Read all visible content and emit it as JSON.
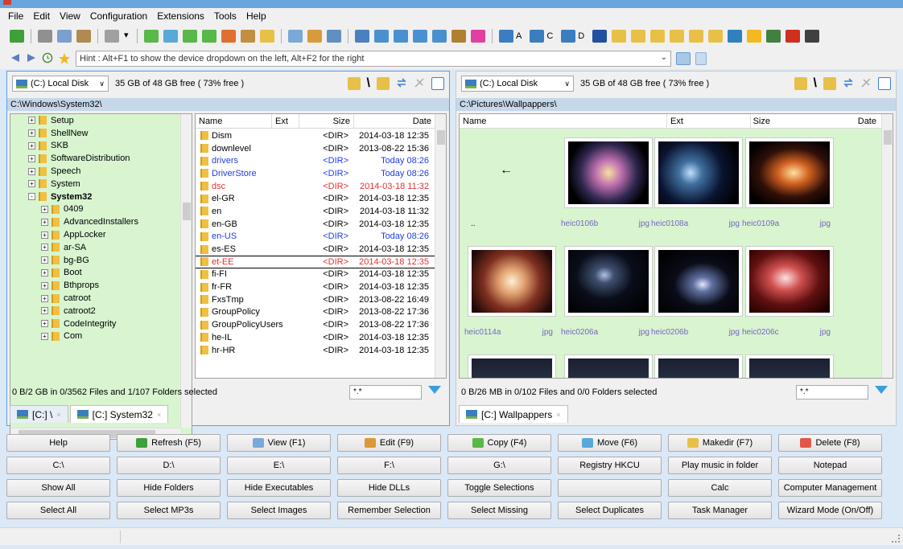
{
  "menu": [
    "File",
    "Edit",
    "View",
    "Configuration",
    "Extensions",
    "Tools",
    "Help"
  ],
  "toolbar": {
    "drive_labels": [
      "A",
      "C",
      "D"
    ]
  },
  "hint": {
    "text": "Hint : Alt+F1 to show the device dropdown on the left, Alt+F2 for the right"
  },
  "left": {
    "drive": "(C:) Local Disk",
    "free": "35 GB of 48 GB free ( 73% free )",
    "path": "C:\\Windows\\System32\\",
    "tree": [
      {
        "label": "Setup",
        "indent": 1,
        "state": "+"
      },
      {
        "label": "ShellNew",
        "indent": 1,
        "state": "+"
      },
      {
        "label": "SKB",
        "indent": 1,
        "state": "+"
      },
      {
        "label": "SoftwareDistribution",
        "indent": 1,
        "state": "+"
      },
      {
        "label": "Speech",
        "indent": 1,
        "state": "+"
      },
      {
        "label": "System",
        "indent": 1,
        "state": "+"
      },
      {
        "label": "System32",
        "indent": 1,
        "state": "-",
        "bold": true
      },
      {
        "label": "0409",
        "indent": 2,
        "state": "+"
      },
      {
        "label": "AdvancedInstallers",
        "indent": 2,
        "state": "+"
      },
      {
        "label": "AppLocker",
        "indent": 2,
        "state": "+"
      },
      {
        "label": "ar-SA",
        "indent": 2,
        "state": "+"
      },
      {
        "label": "bg-BG",
        "indent": 2,
        "state": "+"
      },
      {
        "label": "Boot",
        "indent": 2,
        "state": "+"
      },
      {
        "label": "Bthprops",
        "indent": 2,
        "state": "+"
      },
      {
        "label": "catroot",
        "indent": 2,
        "state": "+"
      },
      {
        "label": "catroot2",
        "indent": 2,
        "state": "+"
      },
      {
        "label": "CodeIntegrity",
        "indent": 2,
        "state": "+"
      },
      {
        "label": "Com",
        "indent": 2,
        "state": "+"
      }
    ],
    "columns": {
      "name": "Name",
      "ext": "Ext",
      "size": "Size",
      "date": "Date"
    },
    "files": [
      {
        "name": "Dism",
        "size": "<DIR>",
        "date": "2014-03-18 12:35",
        "color": "#000000"
      },
      {
        "name": "downlevel",
        "size": "<DIR>",
        "date": "2013-08-22 15:36",
        "color": "#000000"
      },
      {
        "name": "drivers",
        "size": "<DIR>",
        "date": "Today 08:26",
        "color": "#1f3ee0"
      },
      {
        "name": "DriverStore",
        "size": "<DIR>",
        "date": "Today 08:26",
        "color": "#1f3ee0"
      },
      {
        "name": "dsc",
        "size": "<DIR>",
        "date": "2014-03-18 11:32",
        "color": "#e03030"
      },
      {
        "name": "el-GR",
        "size": "<DIR>",
        "date": "2014-03-18 12:35",
        "color": "#000000"
      },
      {
        "name": "en",
        "size": "<DIR>",
        "date": "2014-03-18 11:32",
        "color": "#000000"
      },
      {
        "name": "en-GB",
        "size": "<DIR>",
        "date": "2014-03-18 12:35",
        "color": "#000000"
      },
      {
        "name": "en-US",
        "size": "<DIR>",
        "date": "Today 08:26",
        "color": "#1f3ee0"
      },
      {
        "name": "es-ES",
        "size": "<DIR>",
        "date": "2014-03-18 12:35",
        "color": "#000000"
      },
      {
        "name": "et-EE",
        "size": "<DIR>",
        "date": "2014-03-18 12:35",
        "color": "#e03030",
        "focused": true
      },
      {
        "name": "fi-FI",
        "size": "<DIR>",
        "date": "2014-03-18 12:35",
        "color": "#000000"
      },
      {
        "name": "fr-FR",
        "size": "<DIR>",
        "date": "2014-03-18 12:35",
        "color": "#000000"
      },
      {
        "name": "FxsTmp",
        "size": "<DIR>",
        "date": "2013-08-22 16:49",
        "color": "#000000"
      },
      {
        "name": "GroupPolicy",
        "size": "<DIR>",
        "date": "2013-08-22 17:36",
        "color": "#000000"
      },
      {
        "name": "GroupPolicyUsers",
        "size": "<DIR>",
        "date": "2013-08-22 17:36",
        "color": "#000000"
      },
      {
        "name": "he-IL",
        "size": "<DIR>",
        "date": "2014-03-18 12:35",
        "color": "#000000"
      },
      {
        "name": "hr-HR",
        "size": "<DIR>",
        "date": "2014-03-18 12:35",
        "color": "#000000"
      }
    ],
    "status": "0 B/2 GB in 0/3562 Files and 1/107 Folders selected",
    "filter": "*.*",
    "tabs": [
      "[C:] \\",
      "[C:] System32"
    ]
  },
  "right": {
    "drive": "(C:) Local Disk",
    "free": "35 GB of 48 GB free ( 73% free )",
    "path": "C:\\Pictures\\Wallpappers\\",
    "columns": {
      "name": "Name",
      "ext": "Ext",
      "size": "Size",
      "date": "Date"
    },
    "up_label": "..",
    "thumbs": [
      {
        "name": "heic0106b",
        "ext": "jpg",
        "g": "radial-gradient(circle at 50% 50%,#f8e0a0 0%,#c070b0 25%,#302850 55%,#000 80%)"
      },
      {
        "name": "heic0108a",
        "ext": "jpg",
        "g": "radial-gradient(circle at 40% 50%,#c0e0ff 0%,#4070a0 20%,#0a1430 55%,#000 90%)"
      },
      {
        "name": "heic0109a",
        "ext": "jpg",
        "g": "radial-gradient(ellipse at 55% 50%,#ffe0a0 0%,#d06020 25%,#301008 55%,#000 85%)"
      },
      {
        "name": "heic0114a",
        "ext": "jpg",
        "g": "radial-gradient(circle at 50% 50%,#fff0d0 0%,#e0a070 25%,#803020 55%,#200808 90%)"
      },
      {
        "name": "heic0206a",
        "ext": "jpg",
        "g": "radial-gradient(ellipse at 45% 40%,#b0c0e0 0%,#405070 15%,#0a0e1a 45%,#000 90%)"
      },
      {
        "name": "heic0206b",
        "ext": "jpg",
        "g": "radial-gradient(ellipse at 55% 55%,#e0e8ff 0%,#6070a0 15%,#0a0c18 45%,#000 90%)"
      },
      {
        "name": "heic0206c",
        "ext": "jpg",
        "g": "radial-gradient(ellipse at 45% 45%,#ffe0e0 0%,#d05050 25%,#601010 55%,#200000 90%)"
      }
    ],
    "status": "0 B/26 MB in 0/102 Files and 0/0 Folders selected",
    "filter": "*.*",
    "tabs": [
      "[C:] Wallpappers"
    ]
  },
  "buttons": [
    {
      "label": "Help",
      "icon": ""
    },
    {
      "label": "Refresh (F5)",
      "icon": "#3ea03a"
    },
    {
      "label": "View (F1)",
      "icon": "#7aa8d8"
    },
    {
      "label": "Edit (F9)",
      "icon": "#d89a3a"
    },
    {
      "label": "Copy (F4)",
      "icon": "#58b848"
    },
    {
      "label": "Move (F6)",
      "icon": "#58a8d8"
    },
    {
      "label": "Makedir (F7)",
      "icon": "#e8c048"
    },
    {
      "label": "Delete (F8)",
      "icon": "#e05848"
    },
    {
      "label": "C:\\",
      "icon": ""
    },
    {
      "label": "D:\\",
      "icon": ""
    },
    {
      "label": "E:\\",
      "icon": ""
    },
    {
      "label": "F:\\",
      "icon": ""
    },
    {
      "label": "G:\\",
      "icon": ""
    },
    {
      "label": "Registry HKCU",
      "icon": ""
    },
    {
      "label": "Play music in folder",
      "icon": ""
    },
    {
      "label": "Notepad",
      "icon": ""
    },
    {
      "label": "Show All",
      "icon": ""
    },
    {
      "label": "Hide Folders",
      "icon": ""
    },
    {
      "label": "Hide Executables",
      "icon": ""
    },
    {
      "label": "Hide DLLs",
      "icon": ""
    },
    {
      "label": "Toggle Selections",
      "icon": ""
    },
    {
      "label": "",
      "icon": ""
    },
    {
      "label": "Calc",
      "icon": ""
    },
    {
      "label": "Computer Management",
      "icon": ""
    },
    {
      "label": "Select All",
      "icon": ""
    },
    {
      "label": "Select MP3s",
      "icon": ""
    },
    {
      "label": "Select Images",
      "icon": ""
    },
    {
      "label": "Remember Selection",
      "icon": ""
    },
    {
      "label": "Select Missing",
      "icon": ""
    },
    {
      "label": "Select Duplicates",
      "icon": ""
    },
    {
      "label": "Task Manager",
      "icon": ""
    },
    {
      "label": "Wizard Mode (On/Off)",
      "icon": ""
    }
  ]
}
